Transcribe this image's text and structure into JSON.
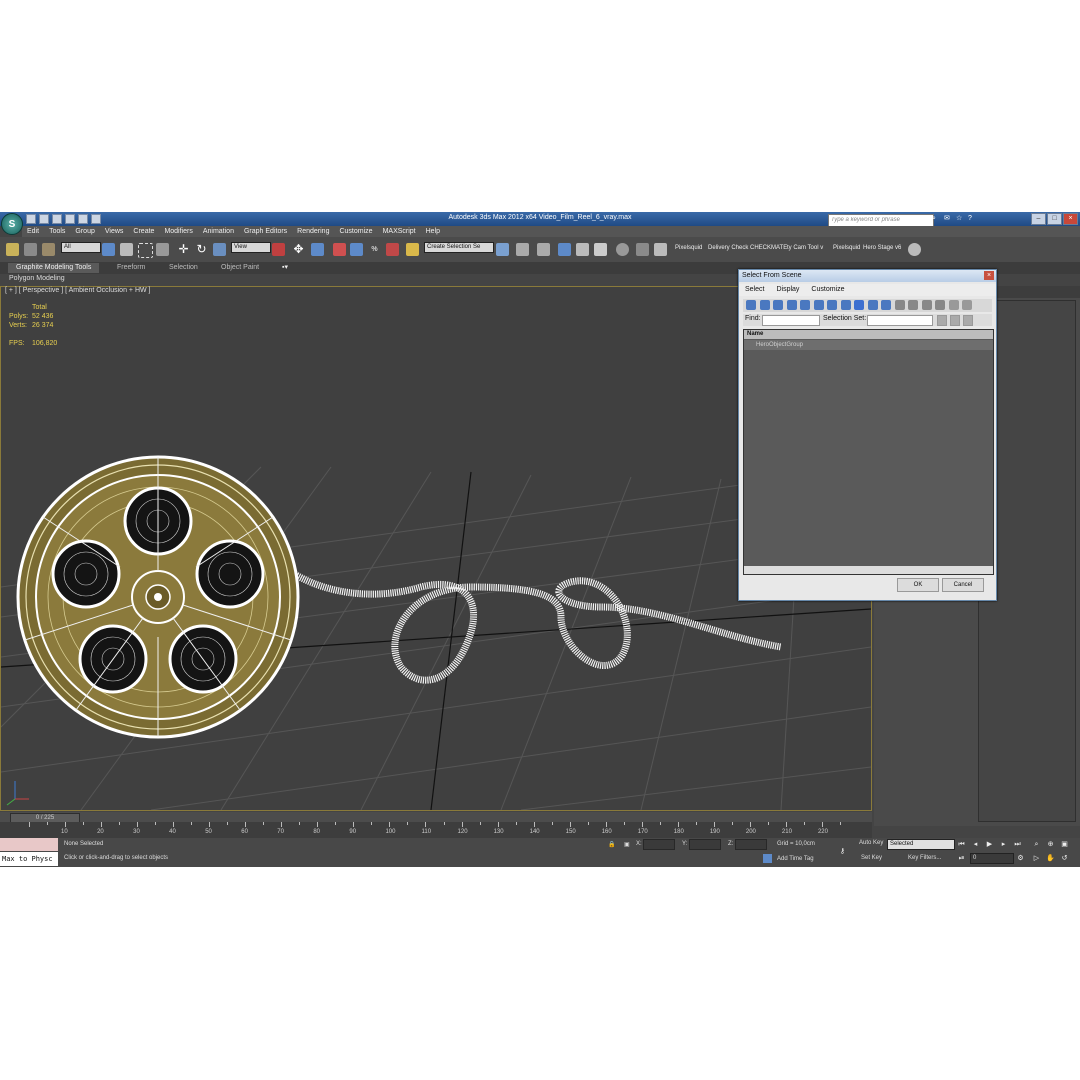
{
  "window": {
    "title": "Autodesk 3ds Max  2012 x64    Video_Film_Reel_6_vray.max",
    "search_placeholder": "Type a keyword or phrase"
  },
  "menu": [
    "Edit",
    "Tools",
    "Group",
    "Views",
    "Create",
    "Modifiers",
    "Animation",
    "Graph Editors",
    "Rendering",
    "Customize",
    "MAXScript",
    "Help"
  ],
  "toolbar": {
    "filter_value": "All",
    "ref_coord_value": "View",
    "selection_set_value": "Create Selection Se",
    "plugins": [
      "Pixelsquid",
      "Delivery Check",
      "CHECKMATE",
      "ty Cam Tool v",
      "Pixelsquid",
      "Hero Stage v6"
    ]
  },
  "ribbon": {
    "tabs": [
      "Graphite Modeling Tools",
      "Freeform",
      "Selection",
      "Object Paint"
    ],
    "panel": "Polygon Modeling"
  },
  "viewport": {
    "label": "[ + ] [ Perspective ] [ Ambient Occlusion + HW ]",
    "stats": {
      "header": "Total",
      "polys_label": "Polys:",
      "polys": "52 436",
      "verts_label": "Verts:",
      "verts": "26 374",
      "fps_label": "FPS:",
      "fps": "106,820"
    }
  },
  "dialog": {
    "title": "Select From Scene",
    "menu": [
      "Select",
      "Display",
      "Customize"
    ],
    "find_label": "Find:",
    "selection_set_label": "Selection Set:",
    "column_name": "Name",
    "items": [
      "HeroObjectGroup"
    ],
    "ok": "OK",
    "cancel": "Cancel"
  },
  "timeline": {
    "frame_label": "0 / 225",
    "ticks": [
      "10",
      "20",
      "30",
      "40",
      "50",
      "60",
      "70",
      "80",
      "90",
      "100",
      "110",
      "120",
      "130",
      "140",
      "150",
      "160",
      "170",
      "180",
      "190",
      "200",
      "210",
      "220"
    ]
  },
  "status": {
    "maxscript": "Max to Physc",
    "selection": "None Selected",
    "prompt": "Click or click-and-drag to select objects",
    "x_label": "X:",
    "y_label": "Y:",
    "z_label": "Z:",
    "grid": "Grid = 10,0cm",
    "add_time_tag": "Add Time Tag",
    "auto_key": "Auto Key",
    "set_key": "Set Key",
    "key_mode_value": "Selected",
    "key_filters": "Key Filters...",
    "current_frame": "0"
  },
  "colors": {
    "titlebar": "#2a5b99",
    "viewport_bg": "#404040",
    "viewport_border": "#8a7a3a",
    "stats_text": "#e8d050",
    "reel": "#b5a24e",
    "wire": "#ffffff"
  }
}
